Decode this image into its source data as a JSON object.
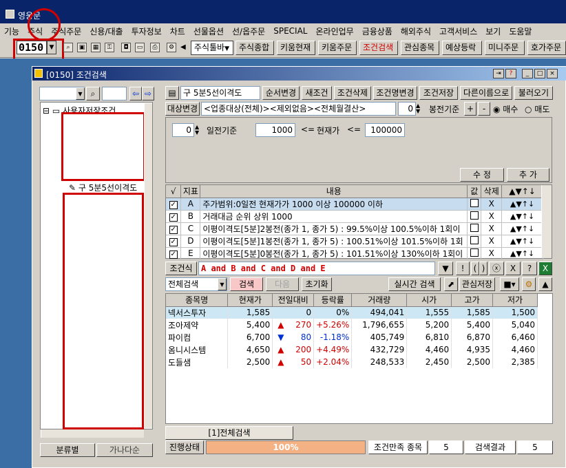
{
  "app": {
    "title": "영웅문"
  },
  "menu": [
    "기능",
    "주식",
    "주식주문",
    "신용/대출",
    "투자정보",
    "차트",
    "선물옵션",
    "선/옵주문",
    "SPECIAL",
    "온라인업무",
    "금융상품",
    "해외주식",
    "고객서비스",
    "보기",
    "도움말"
  ],
  "toolbar": {
    "screen_code": "0150",
    "combo": "주식툴바",
    "buttons": [
      "주식종합",
      "키움현재",
      "키움주문",
      "조건검색",
      "관심종목",
      "예상등락",
      "미니주문",
      "호가주문"
    ]
  },
  "window": {
    "title": "[0150] 조건검색"
  },
  "left": {
    "tree_root": "사용자저장조건",
    "tree_item": "구 5분5선이격도",
    "tab_category": "분류별",
    "tab_alpha": "가나다순"
  },
  "top": {
    "cond_name": "구 5분5선이격도",
    "btn_order": "순서변경",
    "btn_new": "새조건",
    "btn_delete": "조건삭제",
    "btn_rename": "조건명변경",
    "btn_save": "조건저장",
    "btn_saveas": "다른이름으로",
    "btn_load": "불러오기",
    "target_label": "대상변경",
    "target_value": "<업종대상(전체)><제외없음><전체월결산>",
    "bong_value": "0",
    "bong_label": "봉전기준",
    "opt_buy": "매수",
    "opt_sell": "매도"
  },
  "editor": {
    "days_value": "0",
    "days_label": "일전기준",
    "min": "1000",
    "op1": "<=",
    "label": "현재가",
    "op2": "<=",
    "max": "100000",
    "btn_modify": "수 정",
    "btn_add": "추 가"
  },
  "conditions": {
    "headers": [
      "√",
      "지표",
      "내용",
      "값",
      "삭제",
      "▲▼↑↓"
    ],
    "rows": [
      {
        "id": "A",
        "text": "주가범위:0일전 현재가가 1000 이상 100000 이하"
      },
      {
        "id": "B",
        "text": "거래대금 순위 상위 1000"
      },
      {
        "id": "C",
        "text": "이평이격도[5분]2봉전(종가 1, 종가 5) : 99.5%이상 100.5%이하 1회이"
      },
      {
        "id": "D",
        "text": "이평이격도[5분]1봉전(종가 1, 종가 5) : 100.51%이상 101.5%이하 1회"
      },
      {
        "id": "E",
        "text": "이평이격도[5분]0봉전(종가 1, 종가 5) : 101.51%이상 130%이하 1회이"
      }
    ],
    "delete_mark": "X"
  },
  "formula": {
    "label": "조건식",
    "expr": "A and B and C and D and E",
    "ops": [
      "▼",
      "!",
      "(",
      ")",
      "ⓧ",
      "X",
      "?"
    ]
  },
  "search": {
    "mode": "전체검색",
    "btn_search": "검색",
    "btn_next": "다음",
    "btn_reset": "초기화",
    "btn_realtime": "실시간 검색",
    "btn_watch": "관심저장"
  },
  "results": {
    "headers": [
      "종목명",
      "현재가",
      "전일대비",
      "등락률",
      "거래량",
      "시가",
      "고가",
      "저가"
    ],
    "rows": [
      {
        "name": "넥서스투자",
        "price": "1,585",
        "arrow": "",
        "diff": "0",
        "rate": "0%",
        "vol": "494,041",
        "open": "1,555",
        "high": "1,585",
        "low": "1,500"
      },
      {
        "name": "조아제약",
        "price": "5,400",
        "arrow": "▲",
        "diff": "270",
        "rate": "+5.26%",
        "vol": "1,796,655",
        "open": "5,200",
        "high": "5,400",
        "low": "5,040"
      },
      {
        "name": "파이컴",
        "price": "6,700",
        "arrow": "▼",
        "diff": "80",
        "rate": "-1.18%",
        "vol": "405,749",
        "open": "6,810",
        "high": "6,870",
        "low": "6,460"
      },
      {
        "name": "옴니시스템",
        "price": "4,650",
        "arrow": "▲",
        "diff": "200",
        "rate": "+4.49%",
        "vol": "432,729",
        "open": "4,460",
        "high": "4,935",
        "low": "4,460"
      },
      {
        "name": "도들샘",
        "price": "2,500",
        "arrow": "▲",
        "diff": "50",
        "rate": "+2.04%",
        "vol": "248,533",
        "open": "2,450",
        "high": "2,500",
        "low": "2,385"
      }
    ]
  },
  "bottom": {
    "tab": "[1]전체검색",
    "status_label": "진행상태",
    "progress": "100%",
    "progress_fraction": 1.0,
    "match_label": "조건만족 종목",
    "match_count": "5",
    "result_label": "검색결과",
    "result_count": "5"
  }
}
